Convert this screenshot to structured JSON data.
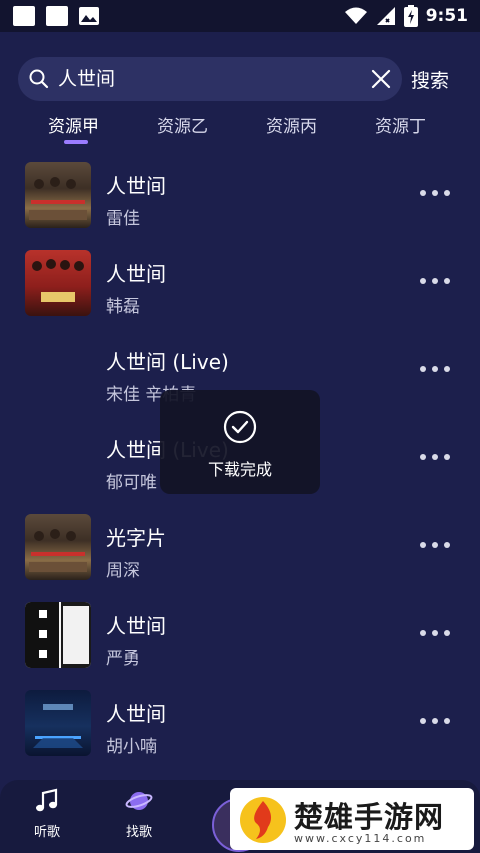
{
  "status_bar": {
    "time": "9:51",
    "battery_icon": "battery-charging-icon",
    "wifi_icon": "wifi-icon",
    "signal_icon": "signal-icon"
  },
  "search": {
    "query": "人世间",
    "button_label": "搜索"
  },
  "tabs": [
    {
      "label": "资源甲",
      "active": true
    },
    {
      "label": "资源乙",
      "active": false
    },
    {
      "label": "资源丙",
      "active": false
    },
    {
      "label": "资源丁",
      "active": false
    }
  ],
  "songs": [
    {
      "title": "人世间",
      "artist": "雷佳",
      "cover": "group-photo"
    },
    {
      "title": "人世间",
      "artist": "韩磊",
      "cover": "red-poster"
    },
    {
      "title": "人世间 (Live)",
      "artist": "宋佳 辛柏青",
      "cover": "none"
    },
    {
      "title": "人世间 (Live)",
      "artist": "郁可唯",
      "cover": "none"
    },
    {
      "title": "光字片",
      "artist": "周深",
      "cover": "group-photo"
    },
    {
      "title": "人世间",
      "artist": "严勇",
      "cover": "book-cover"
    },
    {
      "title": "人世间",
      "artist": "胡小喃",
      "cover": "blue-stage"
    }
  ],
  "toast": {
    "message": "下载完成"
  },
  "bottom_nav": {
    "listen_label": "听歌",
    "find_label": "找歌"
  },
  "watermark": {
    "name": "楚雄手游网",
    "url": "www.cxcy114.com"
  },
  "colors": {
    "background": "#1c1f4c",
    "accent": "#9b7cff",
    "search_bg": "#2d3164"
  }
}
